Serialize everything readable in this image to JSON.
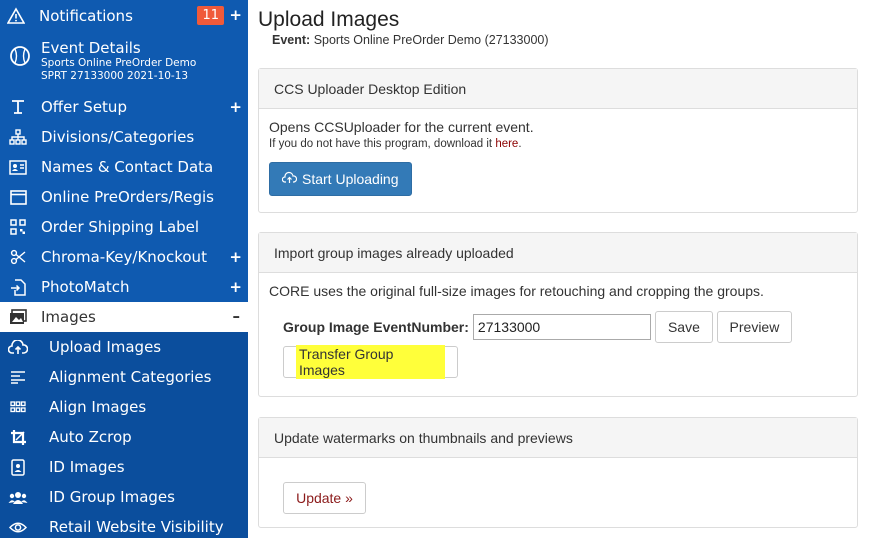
{
  "sidebar": {
    "notifications": {
      "label": "Notifications",
      "badge": "11",
      "expand": "+"
    },
    "event": {
      "title": "Event Details",
      "line1": "Sports Online PreOrder Demo",
      "line2": "SPRT 27133000 2021-10-13"
    },
    "items": [
      {
        "label": "Offer Setup",
        "icon": "text-cursor-icon",
        "expand": "+"
      },
      {
        "label": "Divisions/Categories",
        "icon": "hierarchy-icon",
        "expand": ""
      },
      {
        "label": "Names & Contact Data",
        "icon": "contact-card-icon",
        "expand": ""
      },
      {
        "label": "Online PreOrders/Regis",
        "icon": "window-icon",
        "expand": ""
      },
      {
        "label": "Order Shipping Label",
        "icon": "qrcode-icon",
        "expand": ""
      },
      {
        "label": "Chroma-Key/Knockout",
        "icon": "scissors-icon",
        "expand": "+"
      },
      {
        "label": "PhotoMatch",
        "icon": "file-import-icon",
        "expand": "+"
      }
    ],
    "active": {
      "label": "Images",
      "icon": "images-icon",
      "expand": "–"
    },
    "subitems": [
      {
        "label": "Upload Images",
        "icon": "cloud-upload-icon"
      },
      {
        "label": "Alignment Categories",
        "icon": "align-left-icon"
      },
      {
        "label": "Align Images",
        "icon": "grid-icon"
      },
      {
        "label": "Auto Zcrop",
        "icon": "crop-icon"
      },
      {
        "label": "ID Images",
        "icon": "id-badge-icon"
      },
      {
        "label": "ID Group Images",
        "icon": "users-icon"
      },
      {
        "label": "Retail Website Visibility",
        "icon": "eye-icon"
      }
    ]
  },
  "main": {
    "title": "Upload Images",
    "event_label": "Event:",
    "event_value": "Sports Online PreOrder Demo (27133000)",
    "uploader": {
      "heading": "CCS Uploader Desktop Edition",
      "text": "Opens CCSUploader for the current event.",
      "small_prefix": "If you do not have this program, download it ",
      "small_link": "here",
      "small_suffix": ".",
      "button": "Start Uploading"
    },
    "import": {
      "heading": "Import group images already uploaded",
      "text": "CORE uses the original full-size images for retouching and cropping the groups.",
      "field_label": "Group Image EventNumber:",
      "field_value": "27133000",
      "save": "Save",
      "preview": "Preview",
      "transfer": "Transfer Group Images"
    },
    "watermark": {
      "heading": "Update watermarks on thumbnails and previews",
      "button": "Update »"
    }
  },
  "colors": {
    "sidebar": "#0f5ab0",
    "badge": "#f05a3a",
    "primary": "#337ab7",
    "highlight": "#ffff3a"
  }
}
